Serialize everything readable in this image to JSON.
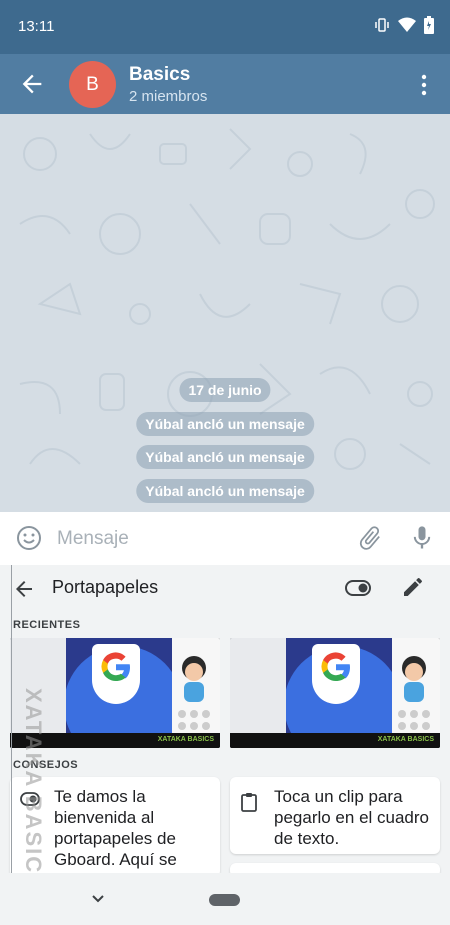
{
  "status_bar": {
    "time": "13:11",
    "icons": [
      "vibrate-icon",
      "wifi-icon",
      "battery-icon"
    ]
  },
  "chat_header": {
    "avatar_letter": "B",
    "title": "Basics",
    "subtitle": "2 miembros",
    "avatar_color": "#e56555",
    "header_color": "#517da2"
  },
  "messages": {
    "date": "17 de junio",
    "service": [
      "Yúbal ancló un mensaje",
      "Yúbal ancló un mensaje",
      "Yúbal ancló un mensaje"
    ]
  },
  "composer": {
    "placeholder": "Mensaje",
    "icons": [
      "emoji-icon",
      "attach-icon",
      "mic-icon"
    ]
  },
  "keyboard": {
    "title": "Portapapeles",
    "recent_label": "RECIENTES",
    "tips_label": "CONSEJOS",
    "thumbnail_brand": "XATAKA BASICS",
    "tips": [
      "Te damos la bienvenida al portapapeles de Gboard. Aquí se",
      "Toca un clip para pegarlo en el cuadro de texto."
    ]
  },
  "watermark": "XATAKA BASICS"
}
